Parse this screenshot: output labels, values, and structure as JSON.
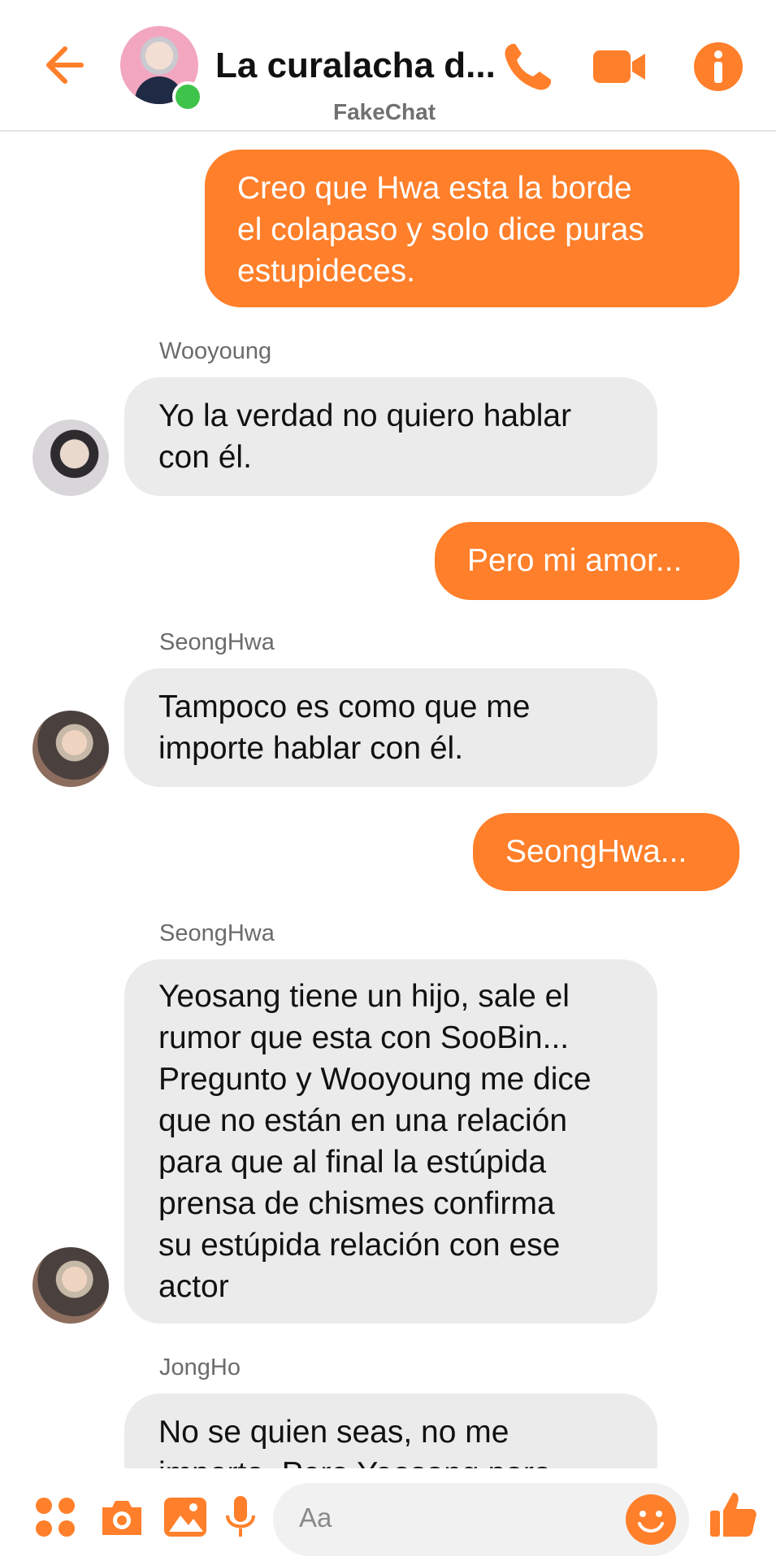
{
  "header": {
    "title": "La curalacha d...",
    "subtitle": "FakeChat",
    "accent_color": "#ff7f2a",
    "icons": [
      "back-arrow-icon",
      "phone-icon",
      "video-camera-icon",
      "info-icon"
    ]
  },
  "messages": [
    {
      "direction": "outgoing",
      "lines": [
        "Creo que Hwa esta la borde",
        "el colapaso y solo dice puras",
        "estupideces."
      ]
    },
    {
      "direction": "incoming",
      "sender": "Wooyoung",
      "lines": [
        "Yo la verdad no quiero hablar",
        "con él."
      ]
    },
    {
      "direction": "outgoing",
      "lines": [
        "Pero mi amor..."
      ]
    },
    {
      "direction": "incoming",
      "sender": "SeongHwa",
      "lines": [
        "Tampoco es como que me",
        "importe hablar con él."
      ]
    },
    {
      "direction": "outgoing",
      "lines": [
        "SeongHwa..."
      ]
    },
    {
      "direction": "incoming",
      "sender": "SeongHwa",
      "lines": [
        "Yeosang tiene un hijo, sale el",
        "rumor que esta con SooBin...",
        "Pregunto y Wooyoung me dice",
        "que no están en una relación",
        "para que al final la estúpida",
        "prensa de chismes confirma",
        "su estúpida relación con ese",
        "actor"
      ]
    },
    {
      "direction": "incoming",
      "sender": "JongHo",
      "lines": [
        "No se quien seas, no me",
        "importa. Pero Yeosang para"
      ]
    }
  ],
  "composer": {
    "placeholder": "Aa",
    "icons": [
      "menu-dots-icon",
      "camera-icon",
      "image-icon",
      "microphone-icon",
      "emoji-icon",
      "thumbs-up-icon"
    ]
  }
}
